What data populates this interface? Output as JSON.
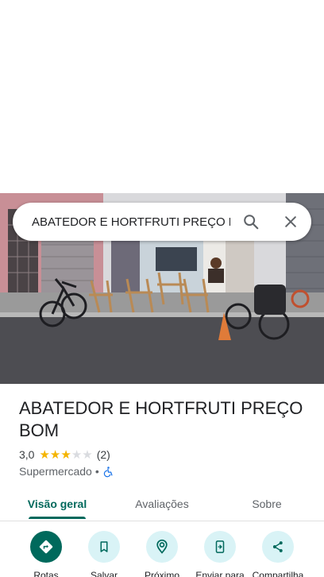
{
  "search": {
    "value": "ABATEDOR E HORTFRUTI PREÇO BOM",
    "search_icon": "search-icon",
    "close_icon": "close-icon"
  },
  "photo": {
    "subject": "storefront-photo"
  },
  "place": {
    "name": "ABATEDOR E HORTFRUTI PREÇO BOM",
    "rating": "3,0",
    "rating_value": 3,
    "stars_max": 5,
    "review_count": "(2)",
    "category": "Supermercado",
    "separator": "•",
    "accessibility_icon": "wheelchair-icon"
  },
  "tabs": [
    {
      "label": "Visão geral",
      "active": true
    },
    {
      "label": "Avaliações",
      "active": false
    },
    {
      "label": "Sobre",
      "active": false
    }
  ],
  "actions": [
    {
      "label": "Rotas",
      "icon": "directions-icon"
    },
    {
      "label": "Salvar",
      "icon": "bookmark-icon"
    },
    {
      "label": "Próximo",
      "icon": "nearby-icon"
    },
    {
      "label": "Enviar para",
      "icon": "send-to-phone-icon"
    },
    {
      "label": "Compartilha",
      "icon": "share-icon"
    }
  ],
  "colors": {
    "accent": "#00695c",
    "action_bg": "#d9f3f6",
    "star_on": "#f4b400",
    "star_off": "#dadce0",
    "accessibility_blue": "#1a73e8"
  }
}
